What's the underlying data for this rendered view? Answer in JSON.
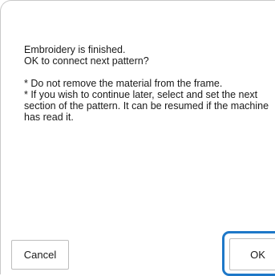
{
  "dialog": {
    "message_lines_1": [
      "Embroidery is finished.",
      "OK to connect next pattern?"
    ],
    "notes": [
      "* Do not remove the material from the frame.",
      "* If you wish to continue later, select and set the next section of the pattern. It can be resumed if the machine has read it."
    ]
  },
  "buttons": {
    "cancel_label": "Cancel",
    "ok_label": "OK"
  },
  "colors": {
    "focus_ring": "#1e78c8"
  }
}
